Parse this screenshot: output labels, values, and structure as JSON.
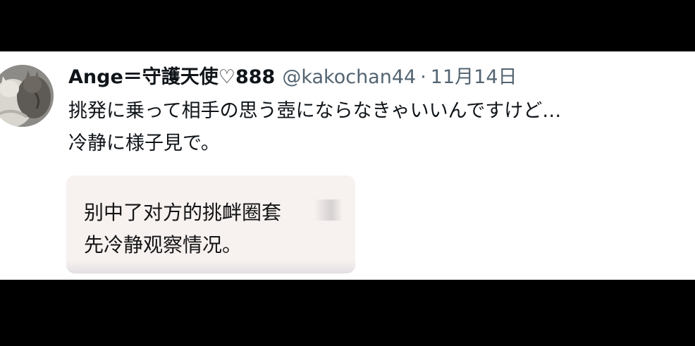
{
  "tweet": {
    "display_name": "Ange＝守護天使♡888",
    "handle": "@kakochan44",
    "separator": "·",
    "date": "11月14日",
    "text_lines": [
      "挑発に乗って相手の思う壺にならなきゃいいんですけど…",
      "冷静に様子見で。"
    ]
  },
  "translation": {
    "lines": [
      "别中了对方的挑衅圈套",
      "先冷静观察情况。"
    ]
  },
  "colors": {
    "text": "#0f1419",
    "secondary": "#536471",
    "card_background": "#f7f1f0"
  },
  "icons": {
    "avatar": "cat-avatar"
  }
}
